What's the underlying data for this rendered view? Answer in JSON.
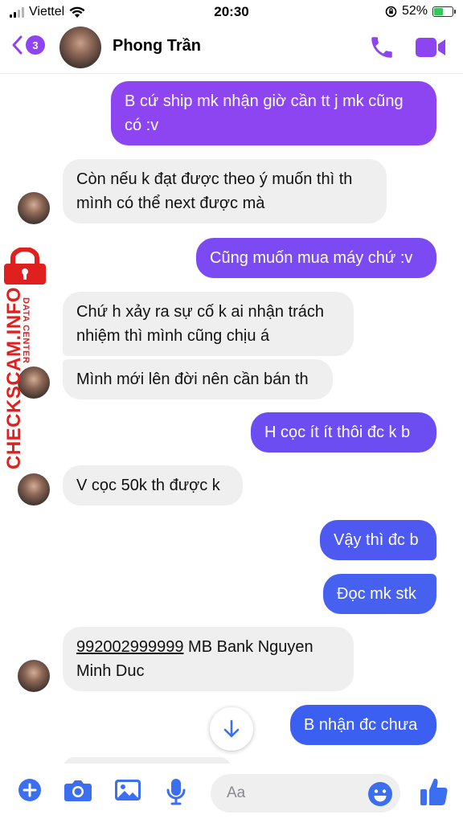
{
  "status_bar": {
    "carrier": "Viettel",
    "time": "20:30",
    "battery": "52%",
    "battery_level": 0.52
  },
  "header": {
    "back_count": "3",
    "contact_name": "Phong Trần"
  },
  "messages": [
    {
      "dir": "out",
      "lines": [
        "B cứ ship mk nhận giờ cần tt j mk cũng",
        "có :v"
      ]
    },
    {
      "dir": "in",
      "lines": [
        "Còn nếu k đạt được theo ý muốn thì th",
        "mình có thể next được mà"
      ]
    },
    {
      "dir": "out",
      "lines": [
        "Cũng muốn mua máy chứ :v"
      ]
    },
    {
      "dir": "in",
      "lines": [
        "Chứ h xảy ra sự cố k ai nhận trách",
        "nhiệm thì mình cũng chịu á"
      ]
    },
    {
      "dir": "in",
      "lines": [
        "Mình mới lên đời nên cần bán th"
      ]
    },
    {
      "dir": "out",
      "lines": [
        "H cọc ít ít thôi đc k b"
      ]
    },
    {
      "dir": "in",
      "lines": [
        "V cọc 50k th được k"
      ]
    },
    {
      "dir": "out",
      "lines": [
        "Vậy thì đc b"
      ]
    },
    {
      "dir": "out",
      "lines": [
        "Đọc mk stk"
      ]
    },
    {
      "dir": "in",
      "account": "992002999999",
      "after_account": " MB Bank Nguyen",
      "line2": "Minh Duc"
    },
    {
      "dir": "out",
      "lines": [
        "B nhận đc chưa"
      ]
    }
  ],
  "composer": {
    "placeholder": "Aa"
  },
  "watermark": {
    "main": "CHECKSCAM.INFO",
    "sub": "DATA CENTER"
  },
  "colors": {
    "purple": "#8d45f2",
    "violet": "#6b4df2",
    "blue": "#3b5ff0",
    "incoming": "#efeff0",
    "watermark": "#e0201f"
  }
}
